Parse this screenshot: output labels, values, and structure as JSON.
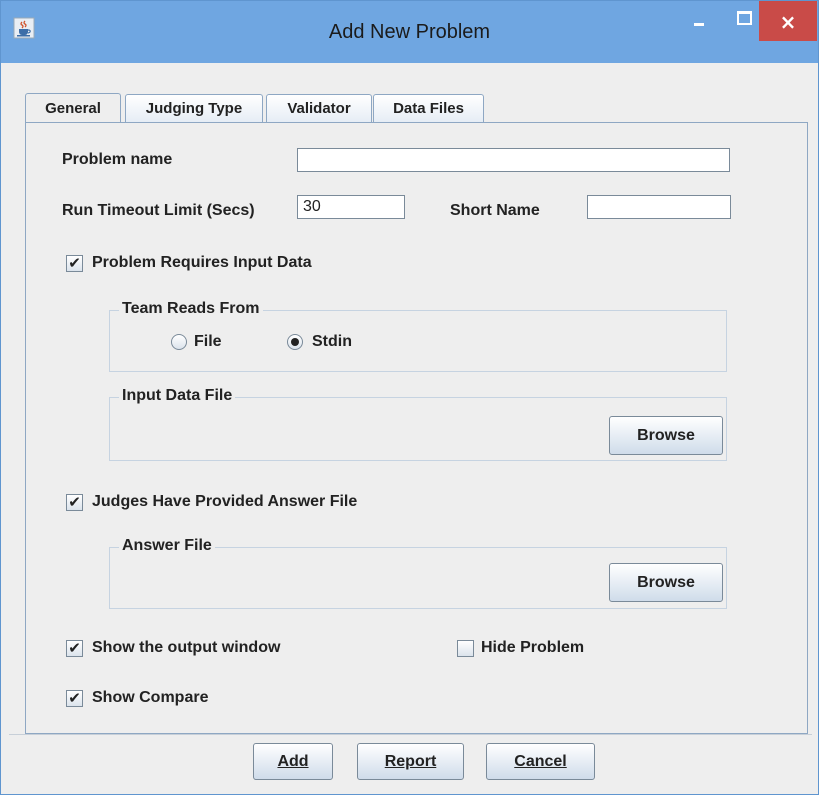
{
  "window": {
    "title": "Add New Problem",
    "close_glyph": "×"
  },
  "tabs": [
    {
      "label": "General",
      "active": true
    },
    {
      "label": "Judging Type",
      "active": false
    },
    {
      "label": "Validator",
      "active": false
    },
    {
      "label": "Data Files",
      "active": false
    }
  ],
  "general": {
    "problem_name_label": "Problem name",
    "problem_name_value": "",
    "run_timeout_label": "Run Timeout Limit (Secs)",
    "run_timeout_value": "30",
    "short_name_label": "Short Name",
    "short_name_value": "",
    "requires_input": {
      "label": "Problem Requires Input Data",
      "checked": true
    },
    "team_reads_from": {
      "title": "Team Reads From",
      "options": [
        {
          "label": "File",
          "selected": false
        },
        {
          "label": "Stdin",
          "selected": true
        }
      ]
    },
    "input_data_file": {
      "title": "Input Data File",
      "browse_label": "Browse"
    },
    "judges_answer": {
      "label": "Judges Have Provided Answer File",
      "checked": true
    },
    "answer_file": {
      "title": "Answer File",
      "browse_label": "Browse"
    },
    "show_output": {
      "label": "Show the output window",
      "checked": true
    },
    "hide_problem": {
      "label": "Hide Problem",
      "checked": false
    },
    "show_compare": {
      "label": "Show Compare",
      "checked": true
    },
    "check_glyph": "✔"
  },
  "footer": {
    "add_label": "Add",
    "report_label": "Report",
    "cancel_label": "Cancel"
  },
  "colors": {
    "titlebar": "#6fa6e1",
    "close_button": "#c94b48",
    "background": "#eeeeee",
    "border": "#8ea7c3"
  },
  "icons": {
    "app": "java-cup-icon",
    "minimize": "minimize-icon",
    "maximize": "maximize-icon",
    "close": "close-icon"
  }
}
